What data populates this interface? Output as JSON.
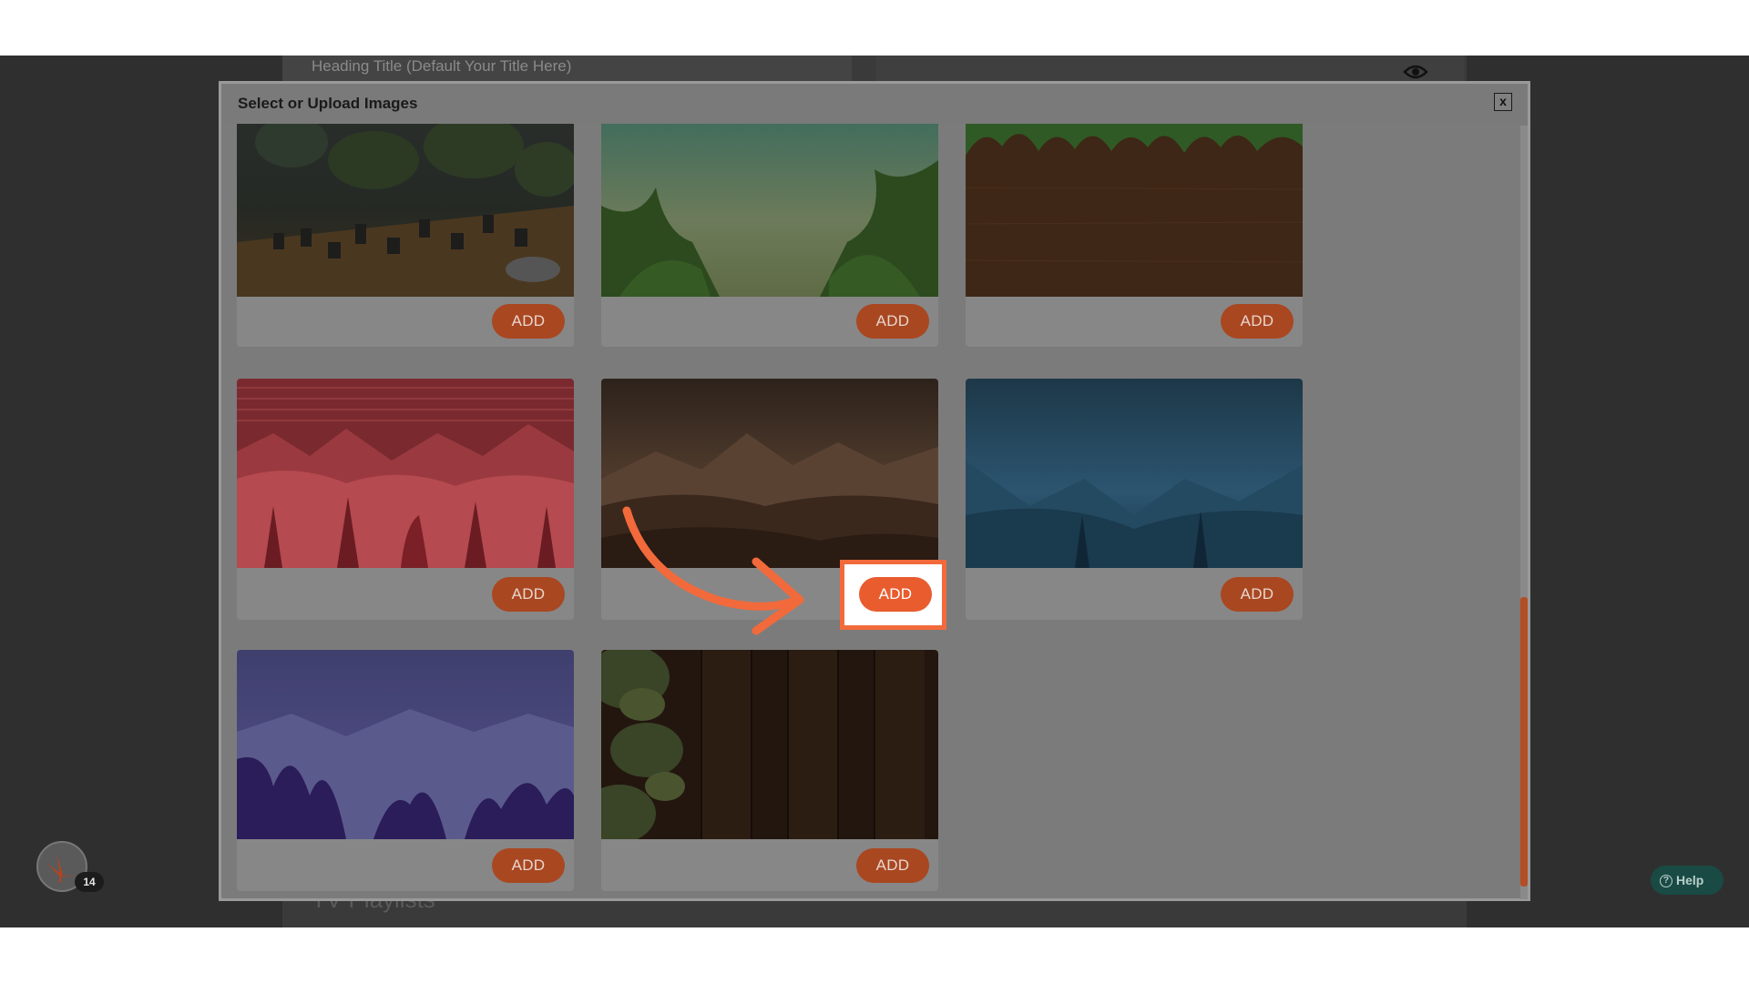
{
  "background": {
    "heading_placeholder": "Heading Title (Default Your Title Here)",
    "section_label": "TV Playlists"
  },
  "modal": {
    "title": "Select or Upload Images",
    "close_label": "x"
  },
  "images": [
    {
      "id": "dispensary-table",
      "add_label": "ADD"
    },
    {
      "id": "green-leaves-sky",
      "add_label": "ADD"
    },
    {
      "id": "wood-planter",
      "add_label": "ADD"
    },
    {
      "id": "red-mountains",
      "add_label": "ADD"
    },
    {
      "id": "brown-mountains",
      "add_label": "ADD",
      "highlighted": true
    },
    {
      "id": "blue-mountains",
      "add_label": "ADD"
    },
    {
      "id": "purple-mountains",
      "add_label": "ADD"
    },
    {
      "id": "dark-wood-buds",
      "add_label": "ADD"
    }
  ],
  "fab": {
    "badge": "14",
    "icon": "cannabis-leaf-icon"
  },
  "help": {
    "label": "Help"
  },
  "colors": {
    "accent": "#e85c2e",
    "add_button_dimmed": "#a94721",
    "overlay": "#2f2f2f",
    "modal_bg": "#7b7b7b"
  }
}
